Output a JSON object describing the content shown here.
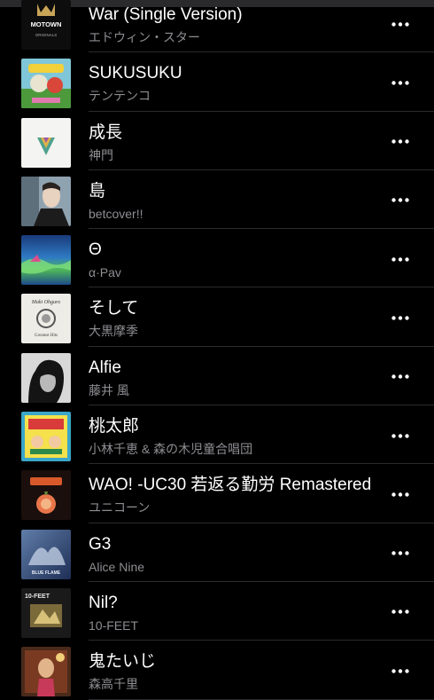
{
  "songs": [
    {
      "title": "War (Single Version)",
      "artist": "エドウィン・スター",
      "art": "motown"
    },
    {
      "title": "SUKUSUKU",
      "artist": "テンテンコ",
      "art": "sukusuku"
    },
    {
      "title": "成長",
      "artist": "神門",
      "art": "seicho"
    },
    {
      "title": "島",
      "artist": "betcover!!",
      "art": "shima"
    },
    {
      "title": "Θ",
      "artist": "α·Pav",
      "art": "theta"
    },
    {
      "title": "そして",
      "artist": "大黒摩季",
      "art": "soshite"
    },
    {
      "title": "Alfie",
      "artist": "藤井 風",
      "art": "alfie"
    },
    {
      "title": "桃太郎",
      "artist": "小林千恵 & 森の木児童合唱団",
      "art": "momotaro"
    },
    {
      "title": "WAO! -UC30 若返る勤労 Remastered",
      "artist": "ユニコーン",
      "art": "wao"
    },
    {
      "title": "G3",
      "artist": "Alice Nine",
      "art": "g3"
    },
    {
      "title": "Nil?",
      "artist": "10-FEET",
      "art": "nil"
    },
    {
      "title": "鬼たいじ",
      "artist": "森高千里",
      "art": "oni"
    }
  ],
  "art_labels": {
    "motown_line1": "MOTOWN",
    "motown_line2": "ORIGINALS",
    "soshite_name": "Maki Ohguro",
    "soshite_sub": "Greatest Hits",
    "g3_label": "BLUE FLAME",
    "nil_label": "10-FEET"
  },
  "more_icon": "ellipsis-icon"
}
